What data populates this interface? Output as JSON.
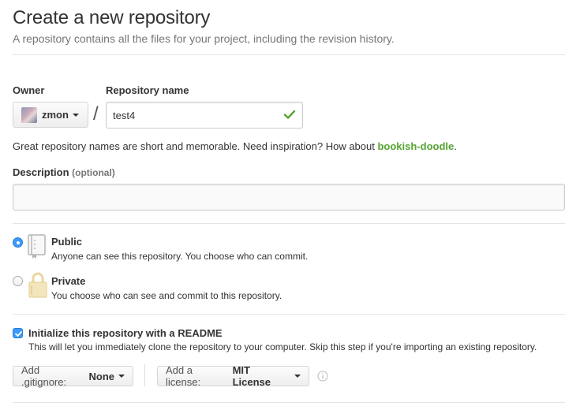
{
  "header": {
    "title": "Create a new repository",
    "subtitle": "A repository contains all the files for your project, including the revision history."
  },
  "owner": {
    "label": "Owner",
    "value": "zmon"
  },
  "separator": "/",
  "repo_name": {
    "label": "Repository name",
    "value": "test4"
  },
  "hint": {
    "text": "Great repository names are short and memorable. Need inspiration? How about ",
    "suggestion": "bookish-doodle",
    "end": "."
  },
  "description": {
    "label": "Description",
    "optional": "(optional)",
    "value": ""
  },
  "visibility": {
    "public": {
      "title": "Public",
      "desc": "Anyone can see this repository. You choose who can commit.",
      "selected": true
    },
    "private": {
      "title": "Private",
      "desc": "You choose who can see and commit to this repository.",
      "selected": false
    }
  },
  "readme": {
    "title": "Initialize this repository with a README",
    "desc": "This will let you immediately clone the repository to your computer. Skip this step if you're importing an existing repository.",
    "checked": true
  },
  "gitignore": {
    "prefix": "Add .gitignore:",
    "value": "None"
  },
  "license": {
    "prefix": "Add a license:",
    "value": "MIT License"
  },
  "colors": {
    "accent": "#3b99fc",
    "success": "#55a532",
    "lock": "#e9d7a0"
  },
  "icons": [
    "check-icon",
    "repo-book-icon",
    "lock-icon",
    "info-icon",
    "caret-down-icon"
  ]
}
